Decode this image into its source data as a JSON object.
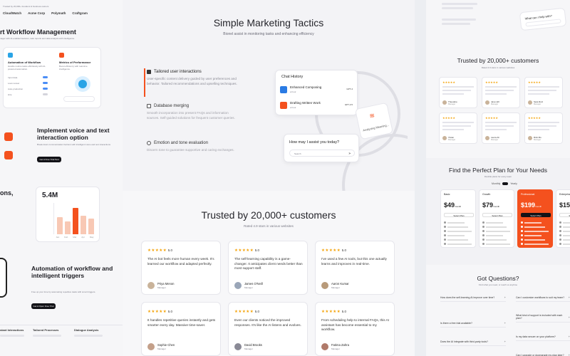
{
  "left": {
    "trusted_note": "Trusted by 20,000+ founders & business owners",
    "logos": [
      "CloudWatch",
      "Acme Corp",
      "Polymath",
      "Craftgram"
    ],
    "workflow_heading": "rt Workflow Management",
    "workflow_sub": "nager with AI-enabled features, task reports and data analysis with intelligence.",
    "card1_title": "Automation of Workflow",
    "card1_desc": "Handle routine tasks effortlessly with AI-powered automation.",
    "card1_rows": [
      "Input data",
      "Loan review",
      "Auto-production",
      "Hire"
    ],
    "card2_title": "Metrics of Performance",
    "card2_desc": "Boost efficiency with real-time intelligence.",
    "voice_heading": "Implement voice and text interaction option",
    "voice_desc": "Break down communication barriers with intelligent voice and text interactions",
    "voice_button": "Get A Free Trial Test",
    "stats_heading": "ons,",
    "stats_value": "5.4M",
    "stats_bars": [
      0.55,
      0.4,
      0.85,
      0.6,
      0.5
    ],
    "stats_axis": [
      "Jan",
      "Feb",
      "Mar",
      "Apr",
      "May"
    ],
    "auto_heading": "Automation of workflow and intelligent triggers",
    "auto_desc": "Free up your time by automating repetitive tasks with smart triggers.",
    "auto_button": "Get A Open Free Trial",
    "footer_items": [
      "stant Interactions",
      "Tailored Processes",
      "Dialogue Analysis"
    ]
  },
  "marketing": {
    "title": "Simple Marketing Tactics",
    "subtitle": "Bionel assist in monitoring tasks and enhancing efficiency",
    "features": [
      {
        "title": "Tailored user interactions",
        "desc": "User-specific content delivery guided by user preferences and behavior. Tailored recommendations and upselling techniques.",
        "icon": "user-icon",
        "active": true
      },
      {
        "title": "Database merging",
        "desc": "Smooth incorporation into present FAQs and information sources. Self-guided solutions for frequent customer queries.",
        "icon": "database-icon",
        "active": false
      },
      {
        "title": "Emotion and tone evaluation",
        "desc": "Discern tone to guarantee supportive and caring exchanges.",
        "icon": "emotion-icon",
        "active": false
      }
    ],
    "chat_history_title": "Chat History",
    "chat_items": [
      {
        "name": "Enhanced Composing",
        "sub": "a hour",
        "model": "GPT-4"
      },
      {
        "name": "Drafting Written Work",
        "sub": "a hour",
        "model": "GPT-3.5"
      }
    ],
    "analyzing_text": "Analyzing Meaning...",
    "assist_question": "How may I assist you today?",
    "assist_placeholder": "Search"
  },
  "testimonials": {
    "title": "Trusted by 20,000+ customers",
    "subtitle": "Rated 4.9 stars in various websites",
    "reviews": [
      {
        "rating": "5.0",
        "text": "The AI bot feels more human every week. It's learned our workflow and adapted perfectly.",
        "name": "Priya Menon",
        "role": "Manager"
      },
      {
        "rating": "5.0",
        "text": "The self-learning capability is a game-changer. It anticipates client needs better than most support staff.",
        "name": "James O'Neill",
        "role": "Manager"
      },
      {
        "rating": "5.0",
        "text": "I've used a few AI tools, but this one actually learns and improves in real-time.",
        "name": "Aaron Kumar",
        "role": "Manager"
      },
      {
        "rating": "5.0",
        "text": "It handles repetitive queries instantly and gets smarter every day. Massive time-saver.",
        "name": "Sophie Chen",
        "role": "Manager"
      },
      {
        "rating": "5.0",
        "text": "Even our clients noticed the improved responses. It's like the AI listens and evolves.",
        "name": "David Brooks",
        "role": "Manager"
      },
      {
        "rating": "5.0",
        "text": "From scheduling help to internal FAQs, this AI assistant has become essential to my workflow.",
        "name": "Fatima Zahra",
        "role": "Manager"
      }
    ]
  },
  "right": {
    "chat_prompt": "What can I help with?",
    "trusted_title": "Trusted by 20,000+ customers",
    "trusted_sub": "Rated 4.9 stars in various websites",
    "mini_reviews": [
      {
        "name": "Theodore",
        "role": "Manager"
      },
      {
        "name": "Jane Hill",
        "role": "Manager"
      },
      {
        "name": "Sara Ruiz",
        "role": "Manager"
      },
      {
        "name": "Vivian",
        "role": "Manager"
      },
      {
        "name": "Laura Ali",
        "role": "Manager"
      },
      {
        "name": "Rick Mo",
        "role": "Manager"
      }
    ],
    "pricing_title": "Find the Perfect Plan for Your Needs",
    "pricing_sub": "Flexible plans for every team",
    "billing": [
      "Monthly",
      "Yearly"
    ],
    "plans": [
      {
        "name": "Basic",
        "price": "$49",
        "period": "/month",
        "cta": "Select Plan",
        "featured": false
      },
      {
        "name": "Growth",
        "price": "$79",
        "period": "/month",
        "cta": "Select Plan",
        "featured": false
      },
      {
        "name": "Professional",
        "price": "$199",
        "period": "/month",
        "cta": "Select Plan",
        "featured": true
      },
      {
        "name": "Enterprise",
        "price": "$159",
        "period": "/month",
        "cta": "Select Plan",
        "featured": false
      }
    ],
    "faq_title": "Got Questions?",
    "faq_sub": "Find what you need, or reach us anytime",
    "faq_left": [
      "How does the self-learning AI improve over time?",
      "Is there a free trial available?",
      "Does the AI integrate with third-party tools?"
    ],
    "faq_right": [
      "Can I customize workflows to suit my team?",
      "What kind of support is included with each plan?",
      "Is my data secure on your platform?",
      "Can I upgrade or downgrade my plan later?"
    ]
  },
  "colors": {
    "accent": "#f4511e",
    "star": "#f4a30a",
    "dark": "#121217"
  }
}
